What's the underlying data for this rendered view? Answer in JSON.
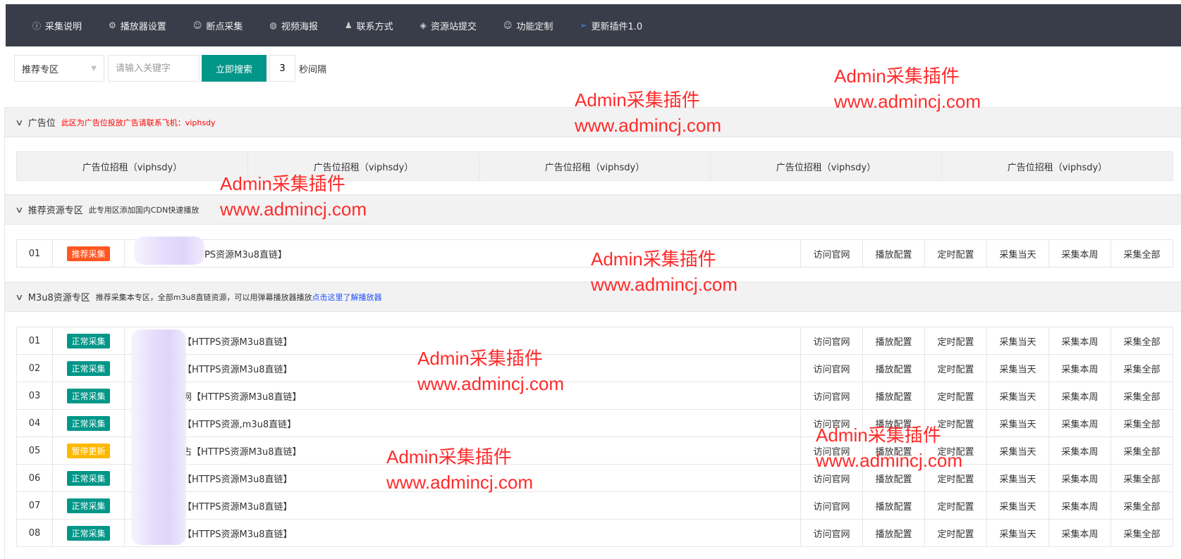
{
  "nav": [
    {
      "icon": "info-icon",
      "glyph": "ⓘ",
      "label": "采集说明"
    },
    {
      "icon": "gear-icon",
      "glyph": "⚙",
      "label": "播放器设置"
    },
    {
      "icon": "face-icon",
      "glyph": "☺",
      "label": "断点采集"
    },
    {
      "icon": "globe-icon",
      "glyph": "◍",
      "label": "视频海报"
    },
    {
      "icon": "user-icon",
      "glyph": "♟",
      "label": "联系方式"
    },
    {
      "icon": "diamond-icon",
      "glyph": "◈",
      "label": "资源站提交"
    },
    {
      "icon": "face-icon",
      "glyph": "☺",
      "label": "功能定制"
    },
    {
      "icon": "send-icon",
      "glyph": "➢",
      "label": "更新插件1.0"
    }
  ],
  "search": {
    "select": "推荐专区",
    "placeholder": "请输入关键字",
    "button": "立即搜索",
    "interval": "3",
    "interval_label": "秒间隔"
  },
  "ad_section": {
    "title": "广告位",
    "desc": "此区为广告位投放广告请联系飞机：viphsdy",
    "slots": [
      "广告位招租（viphsdy）",
      "广告位招租（viphsdy）",
      "广告位招租（viphsdy）",
      "广告位招租（viphsdy）",
      "广告位招租（viphsdy）"
    ]
  },
  "actions": [
    "访问官网",
    "播放配置",
    "定时配置",
    "采集当天",
    "采集本周",
    "采集全部"
  ],
  "recommend_section": {
    "title": "推荐资源专区",
    "desc": "此专用区添加国内CDN快速播放",
    "rows": [
      {
        "no": "01",
        "status": "推荐采集",
        "color": "#ff5722",
        "name": "TPS资源M3u8直链】"
      }
    ]
  },
  "m3u8_section": {
    "title": "M3u8资源专区",
    "desc": "推荐采集本专区，全部m3u8直链资源，可以用弹幕播放器播放",
    "link": "点击这里了解播放器",
    "rows": [
      {
        "no": "01",
        "status": "正常采集",
        "color": "#009688",
        "name": "【HTTPS资源M3u8直链】"
      },
      {
        "no": "02",
        "status": "正常采集",
        "color": "#009688",
        "name": "【HTTPS资源M3u8直链】"
      },
      {
        "no": "03",
        "status": "正常采集",
        "color": "#009688",
        "name": "网【HTTPS资源M3u8直链】"
      },
      {
        "no": "04",
        "status": "正常采集",
        "color": "#009688",
        "name": "【HTTPS资源,m3u8直链】"
      },
      {
        "no": "05",
        "status": "暂停更新",
        "color": "#ffb800",
        "name": "占【HTTPS资源M3u8直链】"
      },
      {
        "no": "06",
        "status": "正常采集",
        "color": "#009688",
        "name": "【HTTPS资源M3u8直链】"
      },
      {
        "no": "07",
        "status": "正常采集",
        "color": "#009688",
        "name": "【HTTPS资源M3u8直链】"
      },
      {
        "no": "08",
        "status": "正常采集",
        "color": "#009688",
        "name": "【HTTPS资源M3u8直链】"
      }
    ]
  },
  "watermark": {
    "line1": "Admin采集插件",
    "line2": "www.admincj.com"
  }
}
